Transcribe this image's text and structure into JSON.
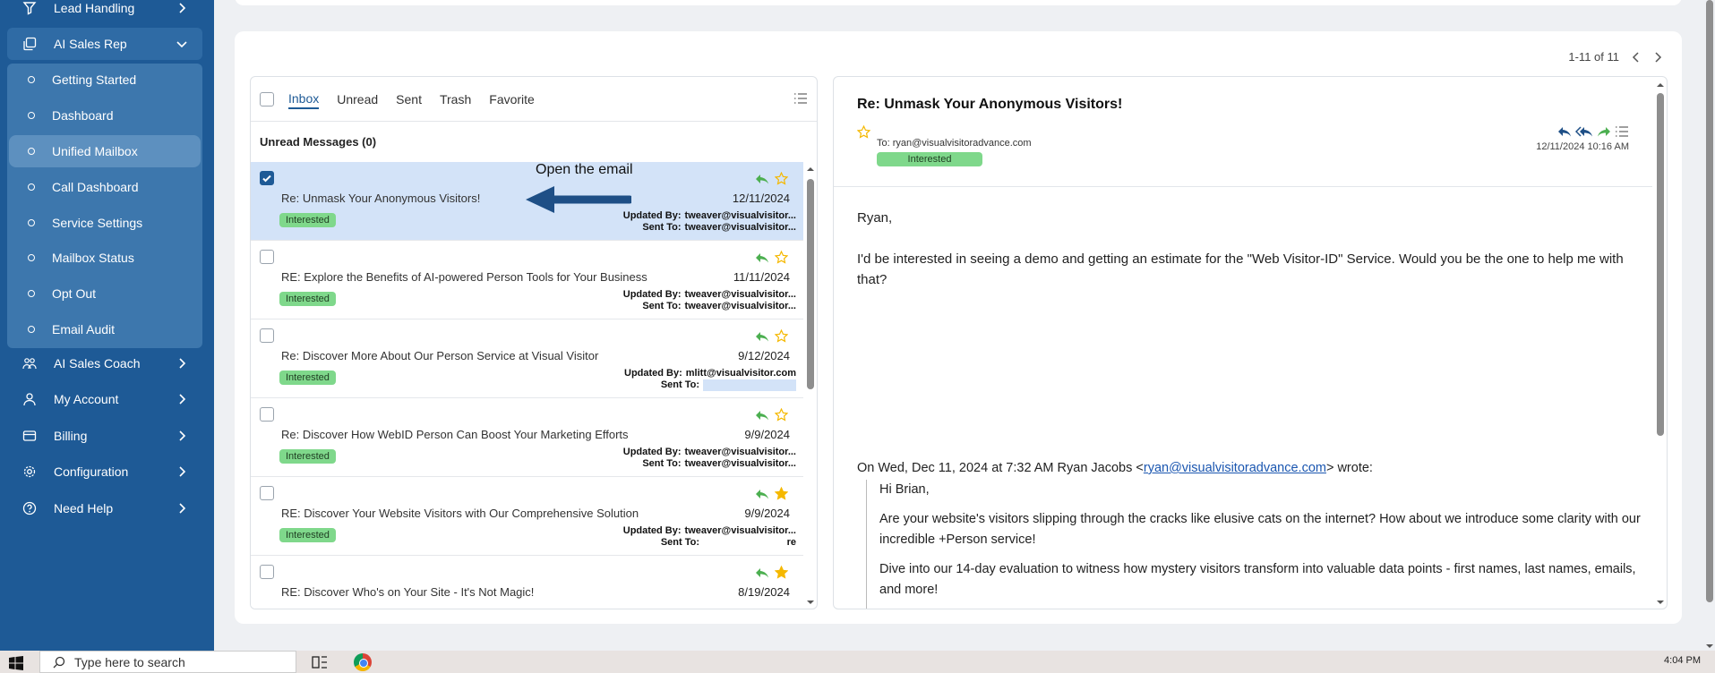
{
  "sidebar": {
    "items": [
      {
        "label": "Lead Handling",
        "icon": "filter-icon"
      },
      {
        "label": "AI Sales Rep",
        "icon": "copy-icon"
      },
      {
        "label": "AI Sales Coach",
        "icon": "group-icon"
      },
      {
        "label": "My Account",
        "icon": "user-icon"
      },
      {
        "label": "Billing",
        "icon": "card-icon"
      },
      {
        "label": "Configuration",
        "icon": "gear-icon"
      },
      {
        "label": "Need Help",
        "icon": "help-icon"
      }
    ],
    "submenu": [
      {
        "label": "Getting Started"
      },
      {
        "label": "Dashboard"
      },
      {
        "label": "Unified Mailbox",
        "active": true
      },
      {
        "label": "Call Dashboard"
      },
      {
        "label": "Service Settings"
      },
      {
        "label": "Mailbox Status"
      },
      {
        "label": "Opt Out"
      },
      {
        "label": "Email Audit"
      }
    ]
  },
  "pager": {
    "range": "1-11 of 11"
  },
  "tabs": [
    "Inbox",
    "Unread",
    "Sent",
    "Trash",
    "Favorite"
  ],
  "unread_title": "Unread Messages (0)",
  "labels": {
    "updated_by": "Updated By:",
    "sent_to": "Sent To:"
  },
  "emails": [
    {
      "subject": "Re: Unmask Your Anonymous Visitors!",
      "date": "12/11/2024",
      "status": "Interested",
      "updated_by": "tweaver@visualvisitor...",
      "sent_to": "tweaver@visualvisitor...",
      "checked": true,
      "starred": false
    },
    {
      "subject": "RE: Explore the Benefits of AI-powered Person Tools for Your Business",
      "date": "11/11/2024",
      "status": "Interested",
      "updated_by": "tweaver@visualvisitor...",
      "sent_to": "tweaver@visualvisitor...",
      "checked": false,
      "starred": false
    },
    {
      "subject": "Re: Discover More About Our Person Service at Visual Visitor",
      "date": "9/12/2024",
      "status": "Interested",
      "updated_by": "mlitt@visualvisitor.com",
      "sent_to": "",
      "sent_to_tail": "",
      "checked": false,
      "starred": false
    },
    {
      "subject": "Re: Discover How WebID Person Can Boost Your Marketing Efforts",
      "date": "9/9/2024",
      "status": "Interested",
      "updated_by": "tweaver@visualvisitor...",
      "sent_to": "tweaver@visualvisitor...",
      "checked": false,
      "starred": false
    },
    {
      "subject": "RE: Discover Your Website Visitors with Our Comprehensive Solution",
      "date": "9/9/2024",
      "status": "Interested",
      "updated_by": "tweaver@visualvisitor...",
      "sent_to": "",
      "sent_to_tail": "re",
      "checked": false,
      "starred": true
    },
    {
      "subject": "RE: Discover Who's on Your Site - It's Not Magic!",
      "date": "8/19/2024",
      "status": "",
      "updated_by": "",
      "sent_to": "",
      "checked": false,
      "starred": true
    }
  ],
  "annotation": {
    "text": "Open the email"
  },
  "reader": {
    "title": "Re: Unmask Your Anonymous Visitors!",
    "to": "To: ryan@visualvisitoradvance.com",
    "status": "Interested",
    "date": "12/11/2024 10:16 AM",
    "greeting": "Ryan,",
    "body": "I'd be interested in seeing a demo and getting an estimate for the \"Web Visitor-ID\" Service.  Would you be the one to help me with that?",
    "quote_prefix": "On Wed, Dec 11, 2024 at 7:32 AM Ryan Jacobs <",
    "quote_email": "ryan@visualvisitoradvance.com",
    "quote_suffix": "> wrote:",
    "quote_lines": [
      "Hi Brian,",
      "Are your website's visitors slipping through the cracks like elusive cats on the internet? How about we introduce some clarity with our incredible +Person service!",
      "Dive into our 14-day evaluation to witness how mystery visitors transform into valuable data points - first names, last names, emails, and more!"
    ]
  },
  "taskbar": {
    "search_placeholder": "Type here to search",
    "clock": "4:04 PM"
  },
  "colors": {
    "sidebar": "#1e5a96",
    "accent": "#1e5a96",
    "badge": "#7fd88b",
    "selected_row": "#d3e3f8",
    "reply": "#4caf50",
    "star": "#f5b800"
  }
}
